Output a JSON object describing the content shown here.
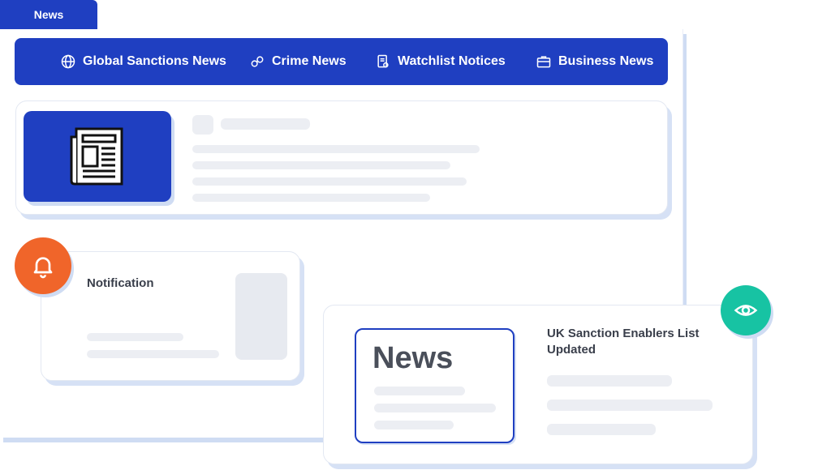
{
  "tab": {
    "label": "News"
  },
  "nav": {
    "items": [
      {
        "label": "Global Sanctions News",
        "icon": "globe-icon"
      },
      {
        "label": "Crime News",
        "icon": "handcuffs-icon"
      },
      {
        "label": "Watchlist Notices",
        "icon": "watchlist-document-icon"
      },
      {
        "label": "Business News",
        "icon": "briefcase-icon"
      }
    ]
  },
  "notification": {
    "title": "Notification"
  },
  "featured": {
    "news_label": "News",
    "title": "UK Sanction Enablers List Updated"
  },
  "colors": {
    "brand_blue": "#1f3fc1",
    "bell_orange": "#f0652a",
    "eye_green": "#17c3a3"
  }
}
